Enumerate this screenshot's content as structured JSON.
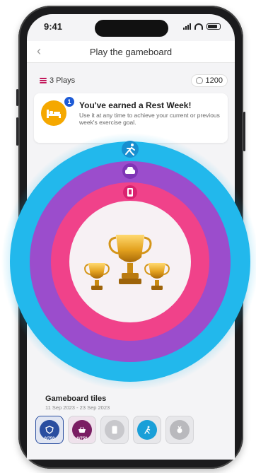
{
  "status": {
    "time": "9:41"
  },
  "nav": {
    "title": "Play the gameboard",
    "back_icon": "chevron-left-icon"
  },
  "plays": {
    "label": "3 Plays",
    "coins": "1200"
  },
  "rest_week": {
    "badge": "1",
    "title": "You've earned a Rest Week!",
    "description": "Use it at any time to achieve your current or previous week's exercise goal."
  },
  "board": {
    "rings": [
      {
        "name": "outer",
        "color": "#22b8ec",
        "icon": "running-icon"
      },
      {
        "name": "middle",
        "color": "#9b4dcc",
        "icon": "car-icon"
      },
      {
        "name": "inner",
        "color": "#f0428a",
        "icon": "phone-icon"
      }
    ],
    "center_color": "#ffffff",
    "trophy_color": "#e0a020"
  },
  "tiles": {
    "title": "Gameboard tiles",
    "date_range": "11 Sep 2023 - 23 Sep 2023",
    "items": [
      {
        "name": "tile-blue",
        "color": "#2a4ea0",
        "label": "0/750",
        "icon": "shield-icon"
      },
      {
        "name": "tile-purple",
        "color": "#7a1e63",
        "label": "0/750",
        "icon": "basket-icon"
      },
      {
        "name": "tile-grey-1",
        "color": "#c8c8cc",
        "label": "",
        "icon": "phone-icon"
      },
      {
        "name": "tile-running",
        "color": "#1a9fd8",
        "label": "",
        "icon": "running-icon"
      },
      {
        "name": "tile-grey-2",
        "color": "#b9b9bd",
        "label": "",
        "icon": "medal-icon"
      }
    ]
  }
}
